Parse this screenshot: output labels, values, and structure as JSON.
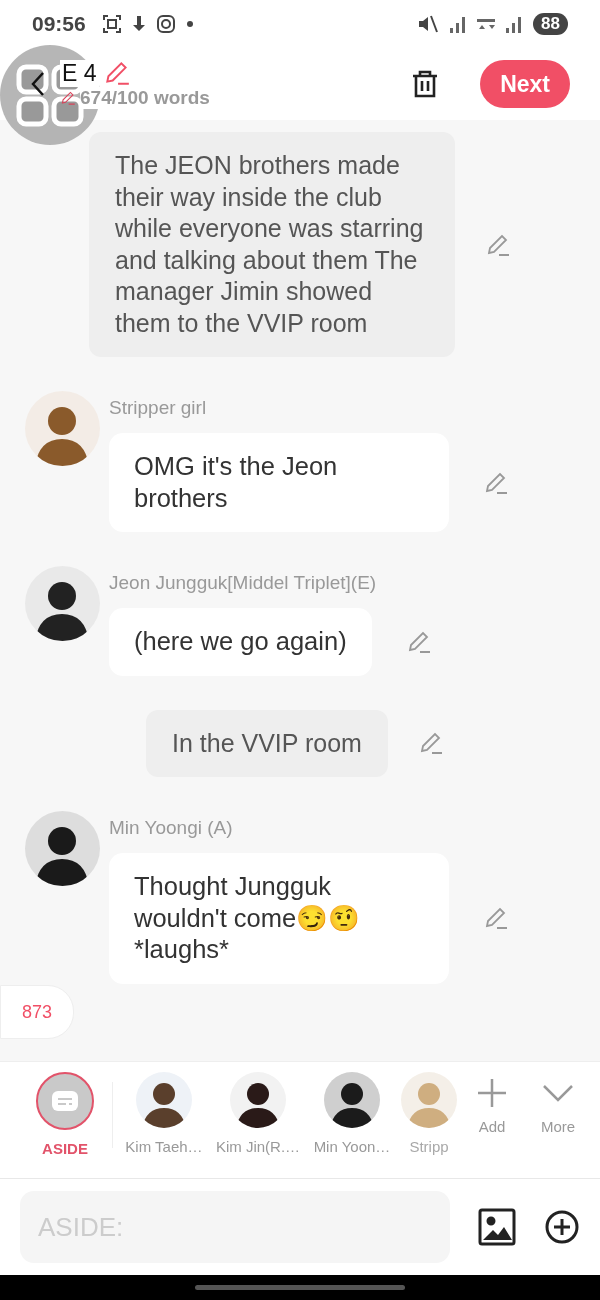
{
  "status_bar": {
    "time": "09:56",
    "battery": "88"
  },
  "header": {
    "title": "E 4",
    "word_count": "674/100 words",
    "next_button": "Next"
  },
  "messages": [
    {
      "kind": "narration",
      "text": "The JEON brothers made their way inside the club while everyone was starring and talking about them The manager Jimin showed them to the VVIP room"
    },
    {
      "kind": "character",
      "name": "Stripper girl",
      "text": "OMG it's the Jeon brothers"
    },
    {
      "kind": "character",
      "name": "Jeon Jungguk[Middel Triplet](E)",
      "text": "(here we go again)"
    },
    {
      "kind": "scene",
      "text": "In the VVIP room"
    },
    {
      "kind": "character",
      "name": "Min Yoongi (A)",
      "text": "Thought Jungguk wouldn't come😏🤨 *laughs*"
    }
  ],
  "counter": "873",
  "characters": [
    {
      "kind": "aside",
      "label": "ASIDE",
      "selected": true
    },
    {
      "kind": "avatar",
      "label": "Kim Taeh…",
      "selected": false
    },
    {
      "kind": "avatar",
      "label": "Kim Jin(R.…",
      "selected": false
    },
    {
      "kind": "avatar",
      "label": "Min Yoon…",
      "selected": false
    },
    {
      "kind": "avatar",
      "label": "Stripp",
      "selected": false
    }
  ],
  "actions": [
    {
      "kind": "add",
      "label": "Add"
    },
    {
      "kind": "more",
      "label": "More"
    }
  ],
  "input": {
    "placeholder": "ASIDE:"
  }
}
